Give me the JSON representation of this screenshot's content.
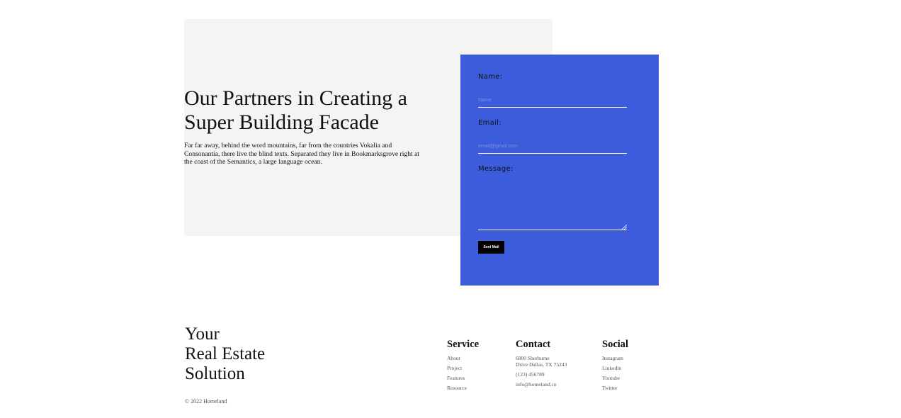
{
  "hero": {
    "title_line1": "Our Partners in Creating a",
    "title_line2": "Super Building Facade",
    "description": "Far far away, behind the word mountains, far from the countries Vokalia and Consonantia, there live the blind texts. Separated they live in Bookmarksgrove right at the coast of the Semantics, a large language ocean."
  },
  "form": {
    "name_label": "Name:",
    "name_placeholder": "Name",
    "email_label": "Email:",
    "email_placeholder": "email@gmail.com",
    "message_label": "Message:",
    "send_label": "Sent Mail",
    "card_color": "#3c5cdb"
  },
  "footer": {
    "brand_line1": "Your",
    "brand_line2": "Real Estate",
    "brand_line3": "Solution",
    "copyright": "© 2022 Homeland",
    "service": {
      "heading": "Service",
      "items": [
        "About",
        "Project",
        "Features",
        "Resource"
      ]
    },
    "contact": {
      "heading": "Contact",
      "address_line1": "6800 Sherburne",
      "address_line2": "Drive Dallas, TX 75243",
      "phone": "(123) 456789",
      "email": "info@homeland.co"
    },
    "social": {
      "heading": "Social",
      "items": [
        "Instagram",
        "Linkedin",
        "Youtube",
        "Twitter"
      ]
    }
  }
}
